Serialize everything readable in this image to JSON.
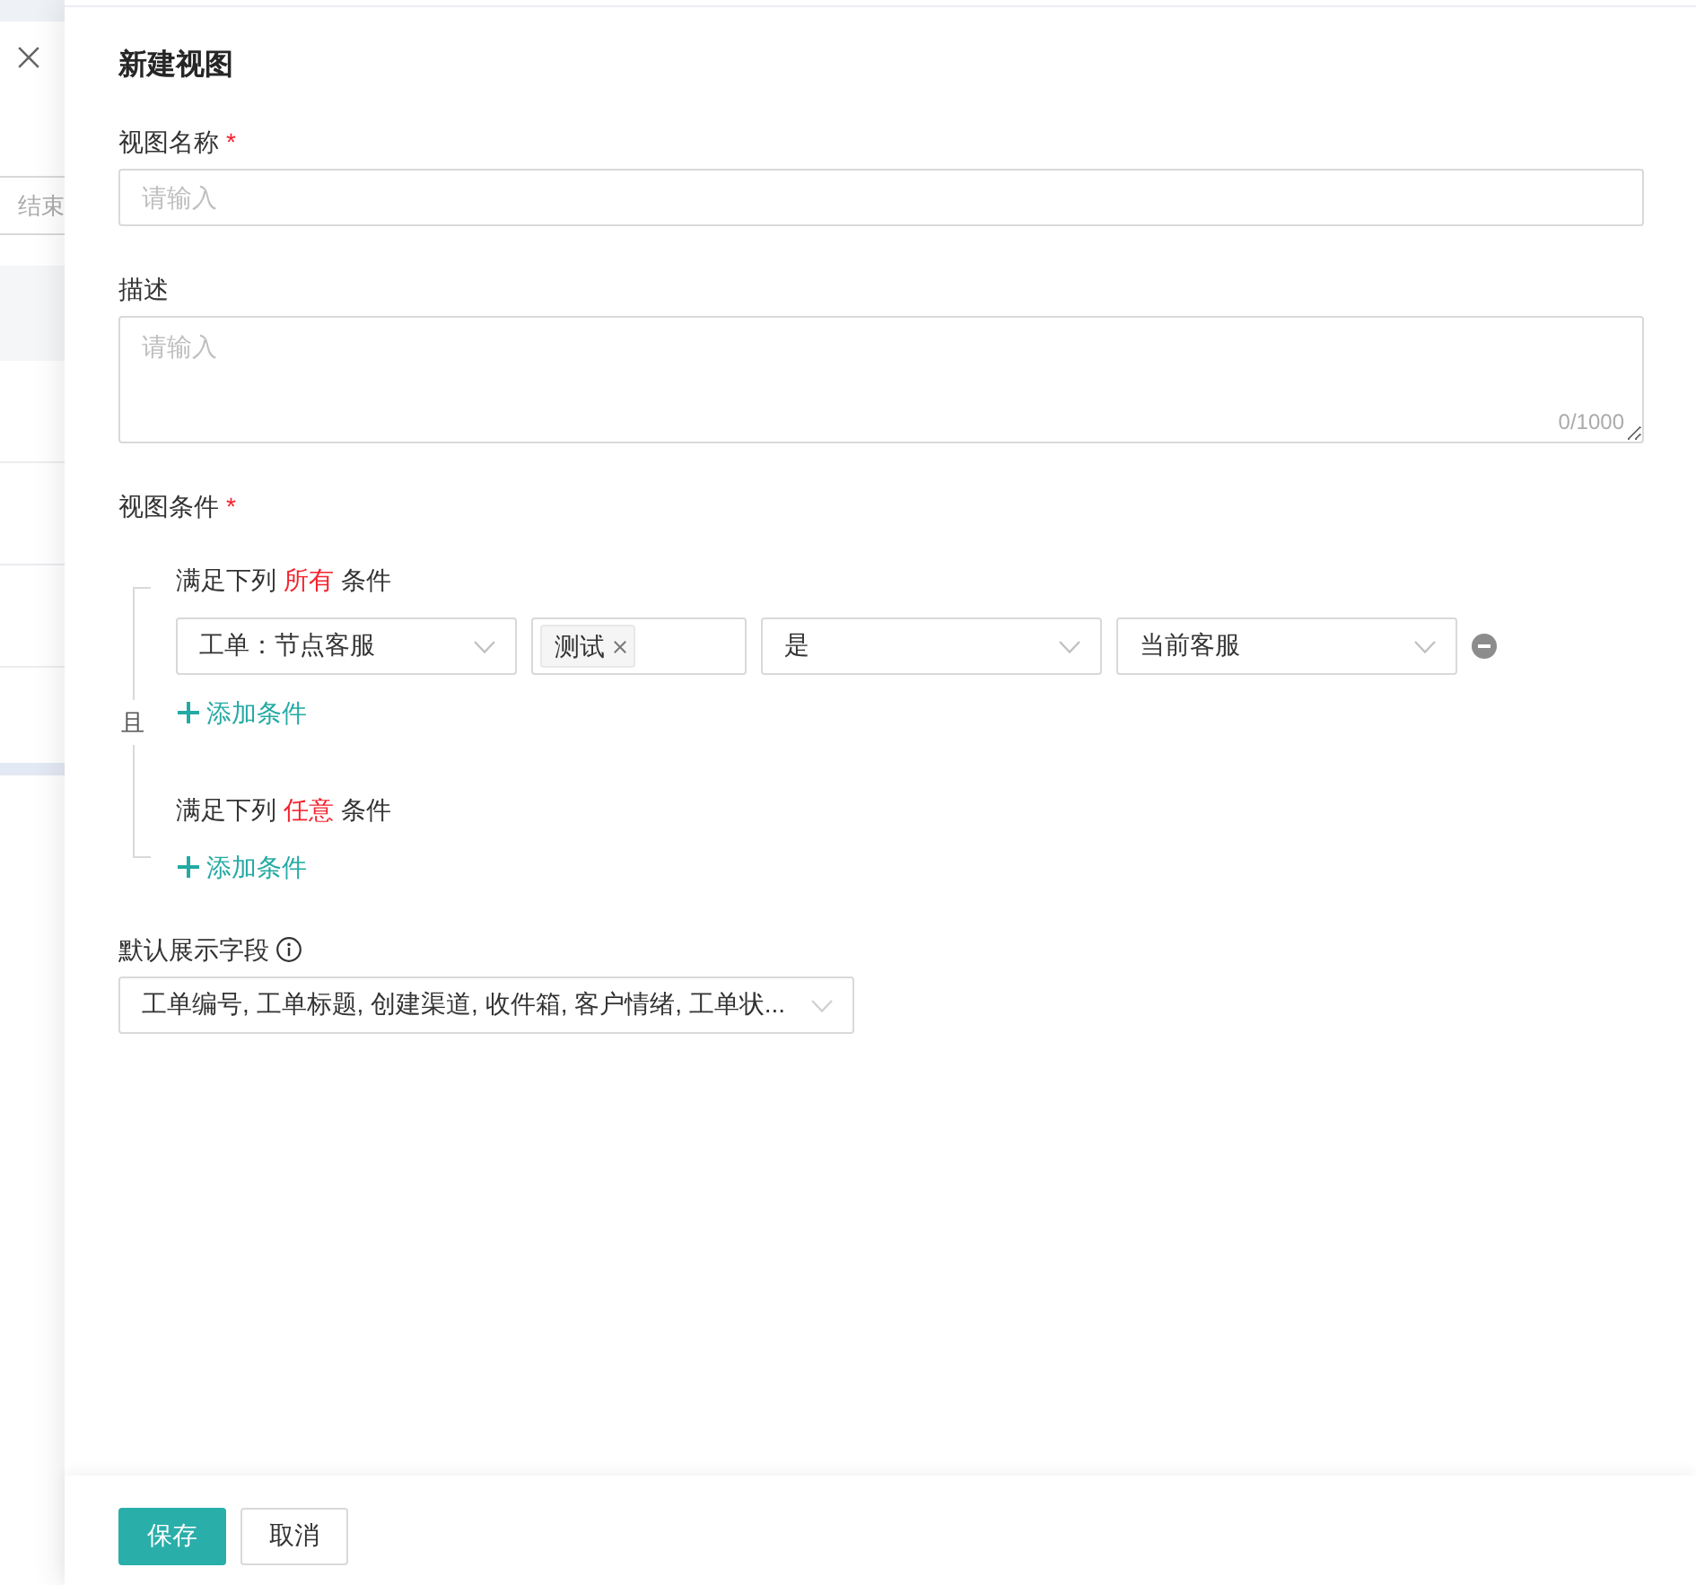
{
  "background": {
    "end_field": {
      "placeholder": "结束"
    }
  },
  "drawer": {
    "title": "新建视图",
    "fields": [
      {
        "kind": "input",
        "label": "视图名称",
        "required_mark": "*",
        "placeholder": "请输入"
      },
      {
        "kind": "textarea",
        "label": "描述",
        "placeholder": "请输入",
        "counter": "0/1000"
      },
      {
        "kind": "conditions",
        "label": "视图条件",
        "required_mark": "*",
        "connector": "且",
        "groups": [
          {
            "prefix": "满足下列",
            "quantifier": "所有",
            "suffix": "条件",
            "conditions": [
              {
                "field": "工单：节点客服",
                "values": [
                  "测试"
                ],
                "operator": "是",
                "value": "当前客服"
              }
            ],
            "add_label": "添加条件"
          },
          {
            "prefix": "满足下列",
            "quantifier": "任意",
            "suffix": "条件",
            "add_label": "添加条件"
          }
        ]
      },
      {
        "kind": "select",
        "label": "默认展示字段",
        "info": true,
        "value": "工单编号, 工单标题, 创建渠道, 收件箱, 客户情绪, 工单状..."
      }
    ]
  },
  "footer": {
    "buttons": [
      {
        "kind": "primary",
        "label": "保存"
      },
      {
        "kind": "default",
        "label": "取消"
      }
    ]
  }
}
